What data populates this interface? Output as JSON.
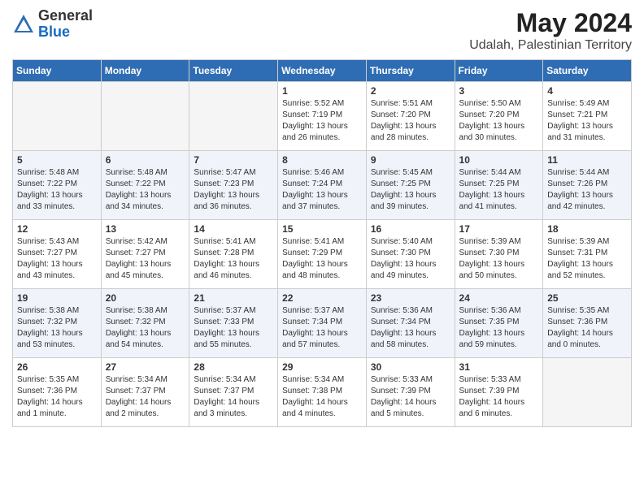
{
  "logo": {
    "general": "General",
    "blue": "Blue"
  },
  "header": {
    "month": "May 2024",
    "location": "Udalah, Palestinian Territory"
  },
  "weekdays": [
    "Sunday",
    "Monday",
    "Tuesday",
    "Wednesday",
    "Thursday",
    "Friday",
    "Saturday"
  ],
  "weeks": [
    [
      {
        "day": "",
        "empty": true
      },
      {
        "day": "",
        "empty": true
      },
      {
        "day": "",
        "empty": true
      },
      {
        "day": "1",
        "sunrise": "5:52 AM",
        "sunset": "7:19 PM",
        "daylight": "13 hours and 26 minutes."
      },
      {
        "day": "2",
        "sunrise": "5:51 AM",
        "sunset": "7:20 PM",
        "daylight": "13 hours and 28 minutes."
      },
      {
        "day": "3",
        "sunrise": "5:50 AM",
        "sunset": "7:20 PM",
        "daylight": "13 hours and 30 minutes."
      },
      {
        "day": "4",
        "sunrise": "5:49 AM",
        "sunset": "7:21 PM",
        "daylight": "13 hours and 31 minutes."
      }
    ],
    [
      {
        "day": "5",
        "sunrise": "5:48 AM",
        "sunset": "7:22 PM",
        "daylight": "13 hours and 33 minutes."
      },
      {
        "day": "6",
        "sunrise": "5:48 AM",
        "sunset": "7:22 PM",
        "daylight": "13 hours and 34 minutes."
      },
      {
        "day": "7",
        "sunrise": "5:47 AM",
        "sunset": "7:23 PM",
        "daylight": "13 hours and 36 minutes."
      },
      {
        "day": "8",
        "sunrise": "5:46 AM",
        "sunset": "7:24 PM",
        "daylight": "13 hours and 37 minutes."
      },
      {
        "day": "9",
        "sunrise": "5:45 AM",
        "sunset": "7:25 PM",
        "daylight": "13 hours and 39 minutes."
      },
      {
        "day": "10",
        "sunrise": "5:44 AM",
        "sunset": "7:25 PM",
        "daylight": "13 hours and 41 minutes."
      },
      {
        "day": "11",
        "sunrise": "5:44 AM",
        "sunset": "7:26 PM",
        "daylight": "13 hours and 42 minutes."
      }
    ],
    [
      {
        "day": "12",
        "sunrise": "5:43 AM",
        "sunset": "7:27 PM",
        "daylight": "13 hours and 43 minutes."
      },
      {
        "day": "13",
        "sunrise": "5:42 AM",
        "sunset": "7:27 PM",
        "daylight": "13 hours and 45 minutes."
      },
      {
        "day": "14",
        "sunrise": "5:41 AM",
        "sunset": "7:28 PM",
        "daylight": "13 hours and 46 minutes."
      },
      {
        "day": "15",
        "sunrise": "5:41 AM",
        "sunset": "7:29 PM",
        "daylight": "13 hours and 48 minutes."
      },
      {
        "day": "16",
        "sunrise": "5:40 AM",
        "sunset": "7:30 PM",
        "daylight": "13 hours and 49 minutes."
      },
      {
        "day": "17",
        "sunrise": "5:39 AM",
        "sunset": "7:30 PM",
        "daylight": "13 hours and 50 minutes."
      },
      {
        "day": "18",
        "sunrise": "5:39 AM",
        "sunset": "7:31 PM",
        "daylight": "13 hours and 52 minutes."
      }
    ],
    [
      {
        "day": "19",
        "sunrise": "5:38 AM",
        "sunset": "7:32 PM",
        "daylight": "13 hours and 53 minutes."
      },
      {
        "day": "20",
        "sunrise": "5:38 AM",
        "sunset": "7:32 PM",
        "daylight": "13 hours and 54 minutes."
      },
      {
        "day": "21",
        "sunrise": "5:37 AM",
        "sunset": "7:33 PM",
        "daylight": "13 hours and 55 minutes."
      },
      {
        "day": "22",
        "sunrise": "5:37 AM",
        "sunset": "7:34 PM",
        "daylight": "13 hours and 57 minutes."
      },
      {
        "day": "23",
        "sunrise": "5:36 AM",
        "sunset": "7:34 PM",
        "daylight": "13 hours and 58 minutes."
      },
      {
        "day": "24",
        "sunrise": "5:36 AM",
        "sunset": "7:35 PM",
        "daylight": "13 hours and 59 minutes."
      },
      {
        "day": "25",
        "sunrise": "5:35 AM",
        "sunset": "7:36 PM",
        "daylight": "14 hours and 0 minutes."
      }
    ],
    [
      {
        "day": "26",
        "sunrise": "5:35 AM",
        "sunset": "7:36 PM",
        "daylight": "14 hours and 1 minute."
      },
      {
        "day": "27",
        "sunrise": "5:34 AM",
        "sunset": "7:37 PM",
        "daylight": "14 hours and 2 minutes."
      },
      {
        "day": "28",
        "sunrise": "5:34 AM",
        "sunset": "7:37 PM",
        "daylight": "14 hours and 3 minutes."
      },
      {
        "day": "29",
        "sunrise": "5:34 AM",
        "sunset": "7:38 PM",
        "daylight": "14 hours and 4 minutes."
      },
      {
        "day": "30",
        "sunrise": "5:33 AM",
        "sunset": "7:39 PM",
        "daylight": "14 hours and 5 minutes."
      },
      {
        "day": "31",
        "sunrise": "5:33 AM",
        "sunset": "7:39 PM",
        "daylight": "14 hours and 6 minutes."
      },
      {
        "day": "",
        "empty": true
      }
    ]
  ]
}
